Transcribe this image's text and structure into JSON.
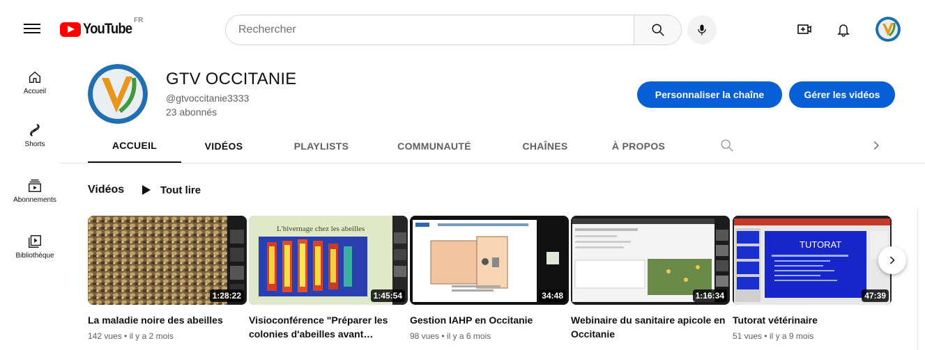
{
  "masthead": {
    "logo_text": "YouTube",
    "region": "FR",
    "search_placeholder": "Rechercher"
  },
  "guide": {
    "items": [
      {
        "label": "Accueil",
        "icon": "home-icon"
      },
      {
        "label": "Shorts",
        "icon": "shorts-icon"
      },
      {
        "label": "Abonnements",
        "icon": "subscriptions-icon"
      },
      {
        "label": "Bibliothèque",
        "icon": "library-icon"
      }
    ]
  },
  "channel": {
    "name": "GTV OCCITANIE",
    "handle": "@gtvoccitanie3333",
    "subscribers": "23 abonnés",
    "customize_label": "Personnaliser la chaîne",
    "manage_label": "Gérer les vidéos"
  },
  "tabs": [
    {
      "label": "ACCUEIL"
    },
    {
      "label": "VIDÉOS"
    },
    {
      "label": "PLAYLISTS"
    },
    {
      "label": "COMMUNAUTÉ"
    },
    {
      "label": "CHAÎNES"
    },
    {
      "label": "À PROPOS"
    }
  ],
  "section": {
    "title": "Vidéos",
    "play_all": "Tout lire"
  },
  "videos": [
    {
      "title": "La maladie noire des abeilles",
      "meta": "142 vues • il y a 2 mois",
      "duration": "1:28:22",
      "thumb_text": ""
    },
    {
      "title": "Visioconférence \"Préparer les colonies d'abeilles avant…",
      "meta": "",
      "duration": "1:45:54",
      "thumb_text": "L'hivernage chez les abeilles"
    },
    {
      "title": "Gestion IAHP en Occitanie",
      "meta": "98 vues • il y a 6 mois",
      "duration": "34:48",
      "thumb_text": ""
    },
    {
      "title": "Webinaire du sanitaire apicole en Occitanie",
      "meta": "",
      "duration": "1:16:34",
      "thumb_text": ""
    },
    {
      "title": "Tutorat vétérinaire",
      "meta": "51 vues • il y a 9 mois",
      "duration": "47:39",
      "thumb_text": "TUTORAT"
    }
  ],
  "colors": {
    "accent_blue": "#065fd4",
    "youtube_red": "#ff0000"
  }
}
